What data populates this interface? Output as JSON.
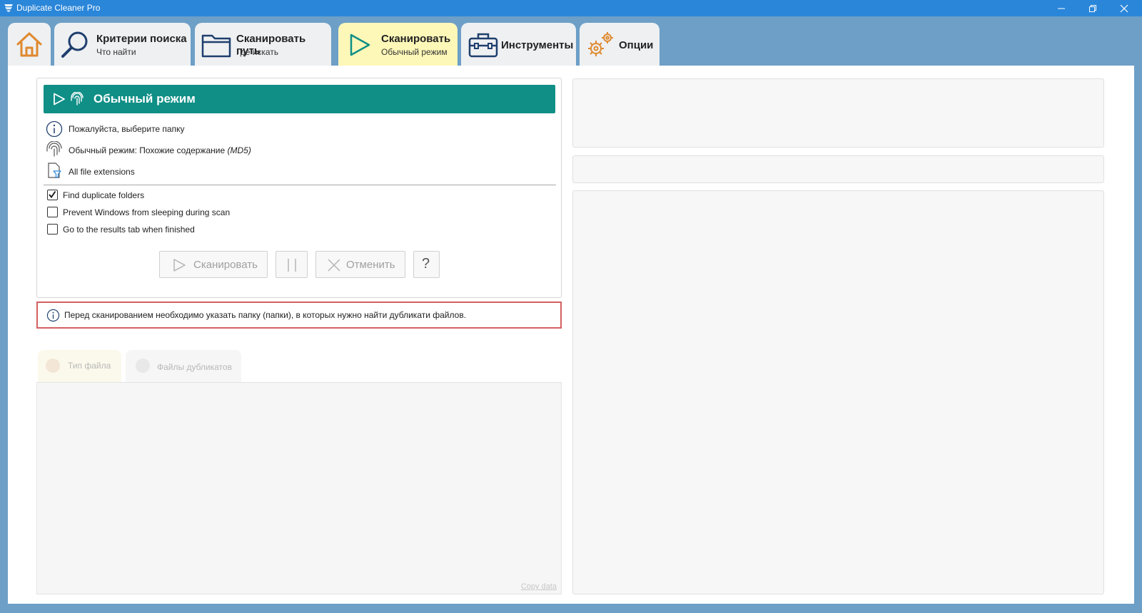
{
  "window": {
    "title": "Duplicate Cleaner Pro"
  },
  "tabs": [
    {
      "label": "Критерии поиска",
      "sub": "Что найти",
      "icon": "magnifier-icon"
    },
    {
      "label": "Сканировать путь",
      "sub": "Где искать",
      "icon": "folder-icon"
    },
    {
      "label": "Сканировать",
      "sub": "Обычный режим",
      "icon": "play-icon",
      "active": true
    },
    {
      "label": "Инструменты",
      "icon": "toolbox-icon"
    },
    {
      "label": "Опции",
      "icon": "gears-icon"
    }
  ],
  "scan_panel": {
    "header": "Обычный режим",
    "info": [
      {
        "text": "Пожалуйста, выберите папку",
        "icon": "info-icon"
      },
      {
        "text": "Обычный режим: Похожие содержание ",
        "italic": "(MD5)",
        "icon": "fingerprint-icon"
      },
      {
        "text": "All file extensions",
        "icon": "file-filter-icon"
      }
    ],
    "options": [
      {
        "label": "Find duplicate folders",
        "checked": true
      },
      {
        "label": "Prevent Windows from sleeping during scan",
        "checked": false
      },
      {
        "label": "Go to the results tab when finished",
        "checked": false
      }
    ],
    "buttons": {
      "scan": "Сканировать",
      "cancel": "Отменить",
      "help": "?"
    }
  },
  "warning": "Перед сканированием необходимо указать папку (папки), в которых нужно найти дубликати файлов.",
  "result_tabs": [
    "Тип файла",
    "Файлы дубликатов"
  ],
  "copy_data": "Copy data",
  "colors": {
    "titlebar": "#2a86d9",
    "background": "#6d9fc7",
    "header": "#0f8f86",
    "active_tab": "#fdf7b8",
    "icon_orange": "#e0892f",
    "icon_navy": "#1f3f6e",
    "warning_border": "#d46060"
  }
}
